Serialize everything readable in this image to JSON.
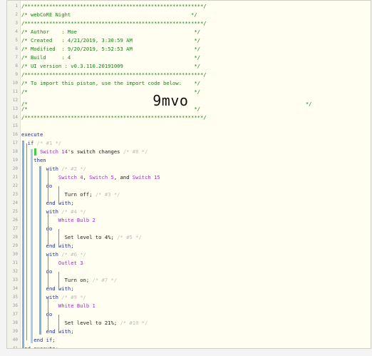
{
  "lines": [
    {
      "n": "1",
      "parts": [
        {
          "t": "/**********************************************************/",
          "c": "cm"
        }
      ]
    },
    {
      "n": "2",
      "parts": [
        {
          "t": "/* webCoRE Night                                       */",
          "c": "cm"
        }
      ]
    },
    {
      "n": "3",
      "parts": [
        {
          "t": "/**********************************************************/",
          "c": "cm"
        }
      ]
    },
    {
      "n": "4",
      "parts": [
        {
          "t": "/* Author    : Moe                                      */",
          "c": "cm"
        }
      ]
    },
    {
      "n": "5",
      "parts": [
        {
          "t": "/* Created   : 4/21/2019, 3:30:59 AM                    */",
          "c": "cm"
        }
      ]
    },
    {
      "n": "6",
      "parts": [
        {
          "t": "/* Modified  : 9/20/2019, 5:52:53 AM                    */",
          "c": "cm"
        }
      ]
    },
    {
      "n": "7",
      "parts": [
        {
          "t": "/* Build     : 4                                        */",
          "c": "cm"
        }
      ]
    },
    {
      "n": "8",
      "parts": [
        {
          "t": "/* UI version : v0.3.110.20191009                       */",
          "c": "cm"
        }
      ]
    },
    {
      "n": "9",
      "parts": [
        {
          "t": "/**********************************************************/",
          "c": "cm"
        }
      ]
    },
    {
      "n": "10",
      "parts": [
        {
          "t": "/* To import this piston, use the import code below:    */",
          "c": "cm"
        }
      ]
    },
    {
      "n": "11",
      "parts": [
        {
          "t": "/*                                                      */",
          "c": "cm"
        }
      ]
    },
    {
      "n": "12",
      "parts": [
        {
          "t": "/*",
          "c": "cm"
        },
        {
          "t": "              9mvo",
          "c": "big"
        },
        {
          "t": "                                      */",
          "c": "cm"
        }
      ]
    },
    {
      "n": "13",
      "parts": [
        {
          "t": "/*                                                      */",
          "c": "cm"
        }
      ]
    },
    {
      "n": "14",
      "parts": [
        {
          "t": "/**********************************************************/",
          "c": "cm"
        }
      ]
    },
    {
      "n": "15",
      "parts": []
    },
    {
      "n": "16",
      "parts": [
        {
          "t": "execute",
          "c": "kw"
        }
      ]
    },
    {
      "n": "17",
      "parts": [
        {
          "t": "  if ",
          "c": "kw"
        },
        {
          "t": "/* #1 */",
          "c": "idc"
        }
      ]
    },
    {
      "n": "18",
      "parts": [
        {
          "t": "      Switch 14",
          "c": "dev"
        },
        {
          "t": "'s switch changes ",
          "c": ""
        },
        {
          "t": "/* #8 */",
          "c": "idc"
        }
      ]
    },
    {
      "n": "19",
      "parts": [
        {
          "t": "    then",
          "c": "kw"
        }
      ]
    },
    {
      "n": "20",
      "parts": [
        {
          "t": "        with ",
          "c": "kw"
        },
        {
          "t": "/* #2 */",
          "c": "idc"
        }
      ]
    },
    {
      "n": "21",
      "parts": [
        {
          "t": "            Switch 4",
          "c": "dev"
        },
        {
          "t": ", ",
          "c": ""
        },
        {
          "t": "Switch 5",
          "c": "dev"
        },
        {
          "t": ", and ",
          "c": ""
        },
        {
          "t": "Switch 15",
          "c": "dev"
        }
      ]
    },
    {
      "n": "22",
      "parts": [
        {
          "t": "        do",
          "c": "kw"
        }
      ]
    },
    {
      "n": "23",
      "parts": [
        {
          "t": "              Turn off; ",
          "c": ""
        },
        {
          "t": "/* #3 */",
          "c": "idc"
        }
      ]
    },
    {
      "n": "24",
      "parts": [
        {
          "t": "        end with;",
          "c": "kw"
        }
      ]
    },
    {
      "n": "25",
      "parts": [
        {
          "t": "        with ",
          "c": "kw"
        },
        {
          "t": "/* #4 */",
          "c": "idc"
        }
      ]
    },
    {
      "n": "26",
      "parts": [
        {
          "t": "            White Bulb 2",
          "c": "dev"
        }
      ]
    },
    {
      "n": "27",
      "parts": [
        {
          "t": "        do",
          "c": "kw"
        }
      ]
    },
    {
      "n": "28",
      "parts": [
        {
          "t": "              Set level to 4%; ",
          "c": ""
        },
        {
          "t": "/* #5 */",
          "c": "idc"
        }
      ]
    },
    {
      "n": "29",
      "parts": [
        {
          "t": "        end with;",
          "c": "kw"
        }
      ]
    },
    {
      "n": "30",
      "parts": [
        {
          "t": "        with ",
          "c": "kw"
        },
        {
          "t": "/* #6 */",
          "c": "idc"
        }
      ]
    },
    {
      "n": "31",
      "parts": [
        {
          "t": "            Outlet 3",
          "c": "dev"
        }
      ]
    },
    {
      "n": "32",
      "parts": [
        {
          "t": "        do",
          "c": "kw"
        }
      ]
    },
    {
      "n": "33",
      "parts": [
        {
          "t": "              Turn on; ",
          "c": ""
        },
        {
          "t": "/* #7 */",
          "c": "idc"
        }
      ]
    },
    {
      "n": "34",
      "parts": [
        {
          "t": "        end with;",
          "c": "kw"
        }
      ]
    },
    {
      "n": "35",
      "parts": [
        {
          "t": "        with ",
          "c": "kw"
        },
        {
          "t": "/* #9 */",
          "c": "idc"
        }
      ]
    },
    {
      "n": "36",
      "parts": [
        {
          "t": "            White Bulb 1",
          "c": "dev"
        }
      ]
    },
    {
      "n": "37",
      "parts": [
        {
          "t": "        do",
          "c": "kw"
        }
      ]
    },
    {
      "n": "38",
      "parts": [
        {
          "t": "              Set level to 21%; ",
          "c": ""
        },
        {
          "t": "/* #10 */",
          "c": "idc"
        }
      ]
    },
    {
      "n": "39",
      "parts": [
        {
          "t": "        end with;",
          "c": "kw"
        }
      ]
    },
    {
      "n": "40",
      "parts": [
        {
          "t": "    end if;",
          "c": "kw"
        }
      ]
    },
    {
      "n": "41",
      "parts": [
        {
          "t": "end execute;",
          "c": "kw"
        }
      ]
    }
  ],
  "colors": {
    "comment": "#1a7f1a",
    "keyword": "#1d2c9c",
    "device": "#a02fc6",
    "id_comment": "#bdbdbd",
    "trigger_marker": "#47c94a",
    "block_bar": "#7fb2e4"
  }
}
